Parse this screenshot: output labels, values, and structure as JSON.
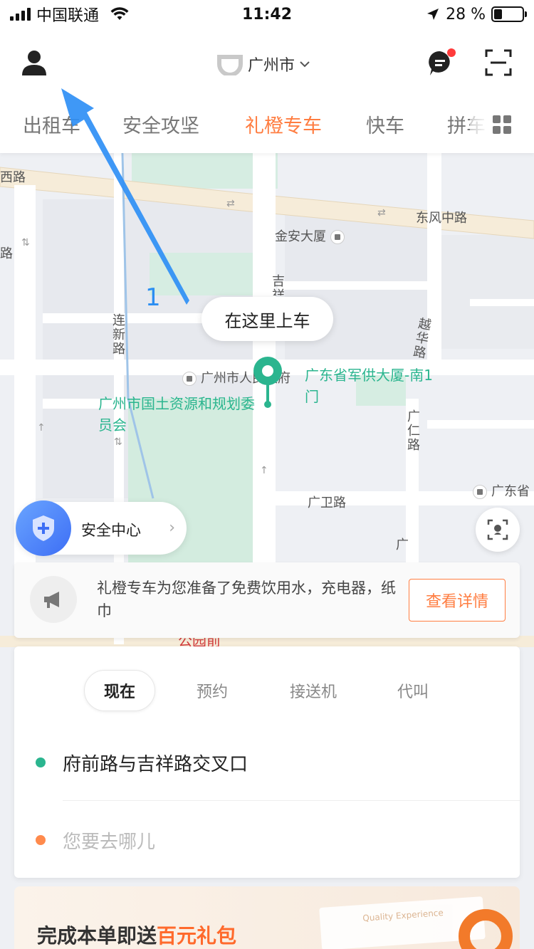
{
  "status_bar": {
    "carrier": "中国联通",
    "time": "11:42",
    "battery": "28 %",
    "battery_level": 0.28
  },
  "header": {
    "profile_icon": "user-icon",
    "city": "广州市",
    "message_icon": "chat-icon",
    "scan_icon": "scan-icon",
    "tabs": [
      "出租车",
      "安全攻坚",
      "礼橙专车",
      "快车",
      "拼车"
    ],
    "active_tab": "礼橙专车",
    "colors": {
      "accent": "#ff7d41",
      "message_badge": "#ff3b3b"
    }
  },
  "annotation": {
    "number": "1",
    "color": "#2b8ef2"
  },
  "map": {
    "labels": {
      "dongfeng_road": "东风中路",
      "jinan_building": "金安大厦",
      "lianxin_road": "连新路",
      "ji_road": "吉祥",
      "yuehua_road": "越华路",
      "guangren_road": "广仁路",
      "guangwei_road": "广卫路",
      "guangdong": "广东省",
      "xi_road": "西路",
      "lu_left": "路",
      "guangzhou_gov": "广州市人民政府",
      "military_building": "广东省军供大厦-南1门",
      "land_bureau": "广州市国土资源和规划委员会",
      "guang": "广",
      "park": "公园前"
    }
  },
  "pickup": {
    "label": "在这里上车",
    "pin_color": "#2bb58f"
  },
  "safety": {
    "label": "安全中心",
    "chevron": "›"
  },
  "notice": {
    "text": "礼橙专车为您准备了免费饮用水，充电器，纸巾",
    "button": "查看详情"
  },
  "booking": {
    "modes": [
      "现在",
      "预约",
      "接送机",
      "代叫"
    ],
    "active_mode": "现在",
    "from": "府前路与吉祥路交叉口",
    "to_placeholder": "您要去哪儿",
    "colors": {
      "from_dot": "#2bb58f",
      "to_dot": "#ff8a4c"
    }
  },
  "promo": {
    "prefix": "完成本单即送",
    "highlight": "百元礼包",
    "card_text": "Quality Experience"
  }
}
